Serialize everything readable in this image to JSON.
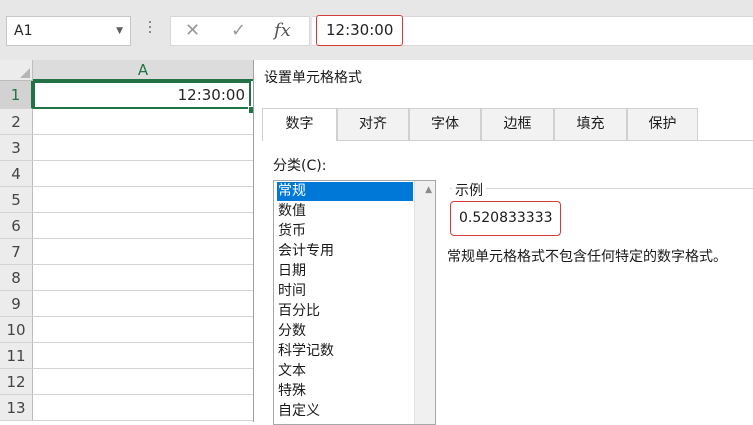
{
  "formula_bar": {
    "name_box": "A1",
    "cancel_icon": "✕",
    "enter_icon": "✓",
    "fx_label": "fx",
    "formula_value": "12:30:00"
  },
  "sheet": {
    "column_header": "A",
    "row_numbers": [
      "1",
      "2",
      "3",
      "4",
      "5",
      "6",
      "7",
      "8",
      "9",
      "10",
      "11",
      "12",
      "13"
    ],
    "cell_a1": "12:30:00"
  },
  "dialog": {
    "title": "设置单元格格式",
    "tabs": [
      "数字",
      "对齐",
      "字体",
      "边框",
      "填充",
      "保护"
    ],
    "active_tab": "数字",
    "category_label": "分类(C):",
    "categories": [
      "常规",
      "数值",
      "货币",
      "会计专用",
      "日期",
      "时间",
      "百分比",
      "分数",
      "科学记数",
      "文本",
      "特殊",
      "自定义"
    ],
    "selected_category": "常规",
    "sample_label": "示例",
    "sample_value": "0.520833333",
    "description": "常规单元格格式不包含任何特定的数字格式。"
  },
  "colors": {
    "excel_green": "#217346",
    "highlight_red": "#d63c3c",
    "selection_blue": "#0078d7"
  }
}
